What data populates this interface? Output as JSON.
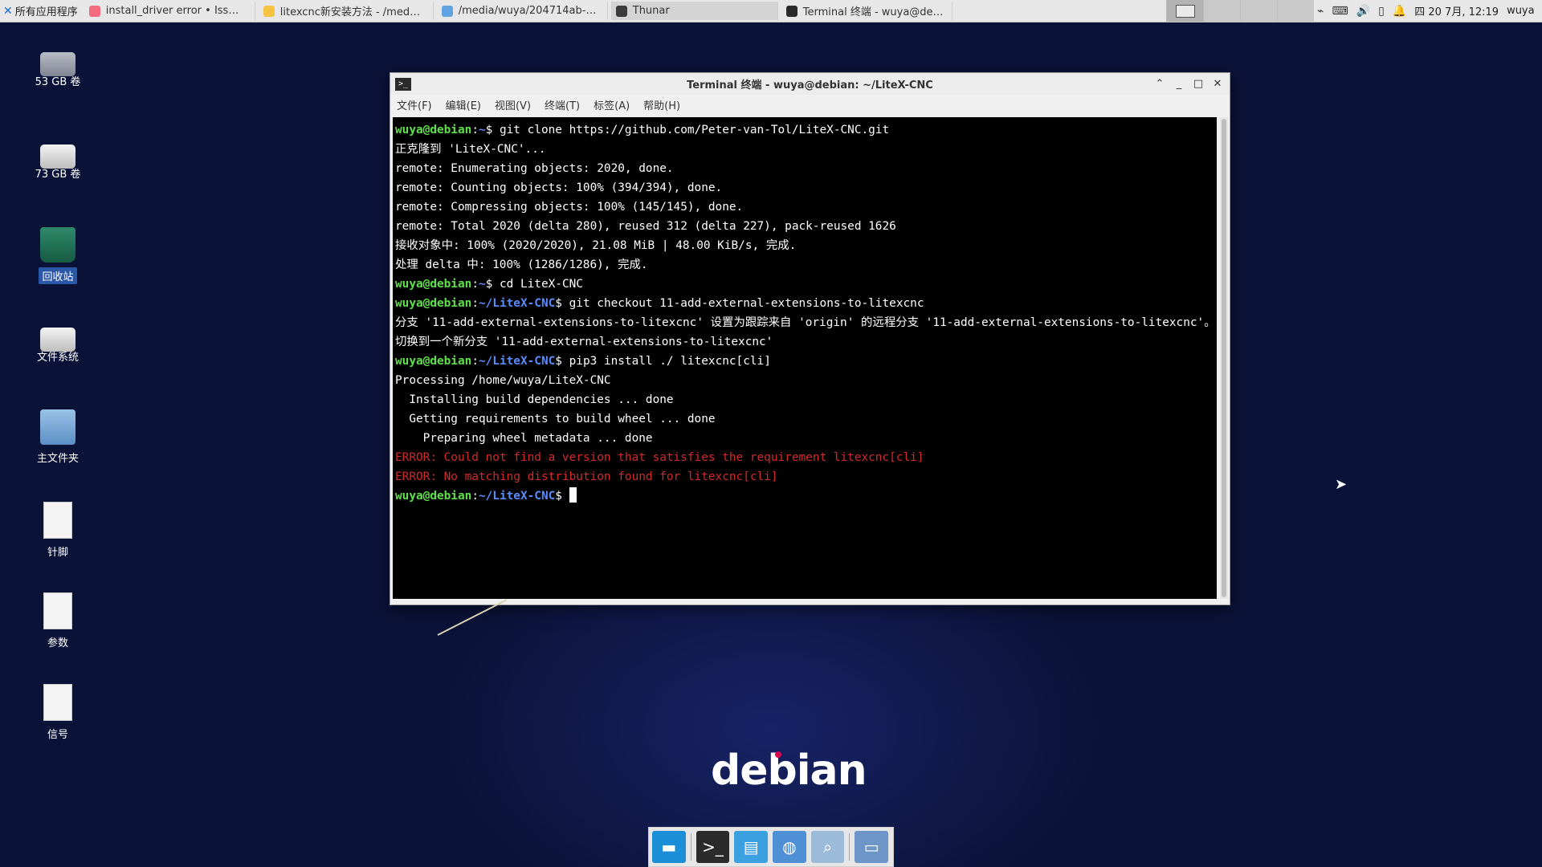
{
  "panel": {
    "apps_menu": "所有应用程序",
    "tasks": [
      {
        "label": "install_driver error • Iss…",
        "icon_color": "#f36b7c"
      },
      {
        "label": "litexcnc新安装方法 - /med…",
        "icon_color": "#f5c342"
      },
      {
        "label": "/media/wuya/204714ab-…",
        "icon_color": "#5fa4e0"
      },
      {
        "label": "Thunar",
        "icon_color": "#3b3b3b"
      },
      {
        "label": "Terminal 终端 - wuya@de…",
        "icon_color": "#2b2b2b"
      }
    ],
    "clock": "四 20 7月, 12:19",
    "user": "wuya"
  },
  "desktop_icons": [
    {
      "label": "53 GB 卷",
      "type": "drive"
    },
    {
      "label": "73 GB 卷",
      "type": "drive-white"
    },
    {
      "label": "回收站",
      "type": "trash"
    },
    {
      "label": "文件系统",
      "type": "drive-white"
    },
    {
      "label": "主文件夹",
      "type": "folder"
    },
    {
      "label": "针脚",
      "type": "doc"
    },
    {
      "label": "参数",
      "type": "doc"
    },
    {
      "label": "信号",
      "type": "doc"
    }
  ],
  "terminal": {
    "title": "Terminal 终端 - wuya@debian: ~/LiteX-CNC",
    "menu": [
      "文件(F)",
      "编辑(E)",
      "视图(V)",
      "终端(T)",
      "标签(A)",
      "帮助(H)"
    ],
    "lines": [
      {
        "prompt_user": "wuya@debian",
        "prompt_path": "~",
        "text": "$ git clone https://github.com/Peter-van-Tol/LiteX-CNC.git"
      },
      {
        "text": "正克隆到 'LiteX-CNC'..."
      },
      {
        "text": "remote: Enumerating objects: 2020, done."
      },
      {
        "text": "remote: Counting objects: 100% (394/394), done."
      },
      {
        "text": "remote: Compressing objects: 100% (145/145), done."
      },
      {
        "text": "remote: Total 2020 (delta 280), reused 312 (delta 227), pack-reused 1626"
      },
      {
        "text": "接收对象中: 100% (2020/2020), 21.08 MiB | 48.00 KiB/s, 完成."
      },
      {
        "text": "处理 delta 中: 100% (1286/1286), 完成."
      },
      {
        "prompt_user": "wuya@debian",
        "prompt_path": "~",
        "text": "$ cd LiteX-CNC"
      },
      {
        "prompt_user": "wuya@debian",
        "prompt_path": "~/LiteX-CNC",
        "text": "$ git checkout 11-add-external-extensions-to-litexcnc"
      },
      {
        "text": "分支 '11-add-external-extensions-to-litexcnc' 设置为跟踪来自 'origin' 的远程分支 '11-add-external-extensions-to-litexcnc'。"
      },
      {
        "text": "切换到一个新分支 '11-add-external-extensions-to-litexcnc'"
      },
      {
        "prompt_user": "wuya@debian",
        "prompt_path": "~/LiteX-CNC",
        "text": "$ pip3 install ./ litexcnc[cli]"
      },
      {
        "text": "Processing /home/wuya/LiteX-CNC"
      },
      {
        "text": "  Installing build dependencies ... done"
      },
      {
        "text": "  Getting requirements to build wheel ... done"
      },
      {
        "text": "    Preparing wheel metadata ... done"
      },
      {
        "text": "ERROR: Could not find a version that satisfies the requirement litexcnc[cli]",
        "error": true
      },
      {
        "text": "ERROR: No matching distribution found for litexcnc[cli]",
        "error": true
      },
      {
        "prompt_user": "wuya@debian",
        "prompt_path": "~/LiteX-CNC",
        "text": "$ ",
        "cursor": true
      }
    ]
  },
  "wallpaper": {
    "logo_text": "debian",
    "accent": "#d70751"
  },
  "dock": [
    {
      "name": "show-desktop",
      "color": "#1a8fd8"
    },
    {
      "name": "terminal",
      "color": "#2b2b2b"
    },
    {
      "name": "file-manager",
      "color": "#3aa0e0"
    },
    {
      "name": "web-browser",
      "color": "#4f8fd6"
    },
    {
      "name": "app-finder",
      "color": "#9bbbd8"
    },
    {
      "name": "folder",
      "color": "#6c95c8"
    }
  ]
}
